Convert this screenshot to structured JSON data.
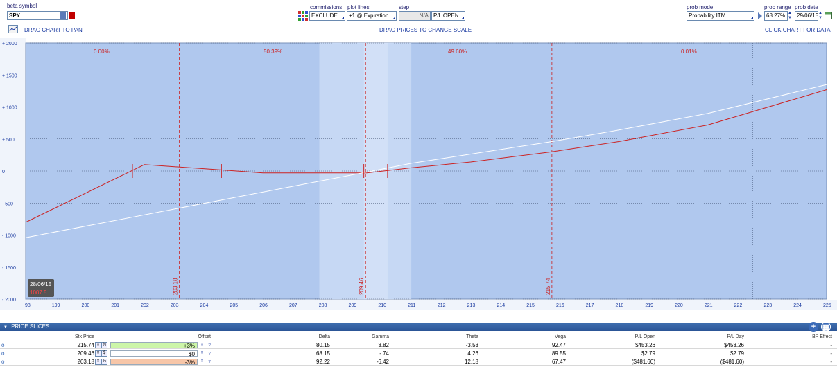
{
  "toolbar": {
    "beta_symbol_label": "beta symbol",
    "beta_symbol_value": "SPY",
    "commissions_label": "commissions",
    "commissions_value": "EXCLUDE",
    "plot_lines_label": "plot lines",
    "plot_lines_value": "+1 @ Expiration",
    "step_label": "step",
    "step_value": "N/A",
    "pl_value": "P/L OPEN",
    "prob_mode_label": "prob mode",
    "prob_mode_value": "Probability ITM",
    "prob_range_label": "prob range",
    "prob_range_value": "68.27%",
    "prob_date_label": "prob date",
    "prob_date_value": "29/06/15"
  },
  "hints": {
    "pan": "DRAG CHART TO PAN",
    "scale": "DRAG PRICES TO CHANGE SCALE",
    "data": "CLICK CHART FOR DATA"
  },
  "chart_data": {
    "type": "line",
    "x_ticks": [
      98,
      199,
      200,
      201,
      202,
      203,
      204,
      205,
      206,
      207,
      208,
      209,
      210,
      211,
      212,
      213,
      214,
      215,
      216,
      217,
      218,
      219,
      220,
      221,
      222,
      223,
      224,
      225
    ],
    "y_ticks": [
      2000,
      1500,
      1000,
      500,
      0,
      -500,
      -1000,
      -1500,
      -2000
    ],
    "y_tick_labels": [
      "+ 2000",
      "+ 1500",
      "+ 1000",
      "+ 500",
      "0",
      "- 500",
      "- 1000",
      "- 1500",
      "- 2000"
    ],
    "xlim": [
      198,
      225
    ],
    "ylim": [
      -2000,
      2000
    ],
    "probabilities": [
      "0.00%",
      "50.39%",
      "49.60%",
      "0.01%"
    ],
    "slice_lines": [
      {
        "x": 203.18,
        "label": "203.18"
      },
      {
        "x": 209.46,
        "label": "209.46"
      },
      {
        "x": 215.74,
        "label": "215.74"
      }
    ],
    "sigma_lines": [
      200,
      222.5
    ],
    "highlight_band": [
      207.9,
      211.0
    ],
    "current_band": [
      209.4,
      210.2
    ],
    "series": [
      {
        "color": "#cc2222",
        "points": [
          [
            198,
            -800
          ],
          [
            202,
            100
          ],
          [
            204.5,
            20
          ],
          [
            206,
            -30
          ],
          [
            209.5,
            -30
          ],
          [
            211,
            50
          ],
          [
            213,
            140
          ],
          [
            215.74,
            300
          ],
          [
            218,
            460
          ],
          [
            221,
            720
          ],
          [
            225,
            1270
          ]
        ]
      },
      {
        "color": "#ffffff",
        "points": [
          [
            198,
            -1040
          ],
          [
            209.46,
            -20
          ],
          [
            211,
            120
          ],
          [
            215.74,
            460
          ],
          [
            218,
            640
          ],
          [
            221,
            900
          ],
          [
            225,
            1350
          ]
        ]
      }
    ],
    "strike_marks": [
      201.6,
      204.6,
      209.4,
      210.2
    ],
    "tooltip": {
      "date": "28/06/15",
      "value": "1007.5"
    }
  },
  "price_slices": {
    "title": "PRICE SLICES",
    "columns": [
      "Stk Price",
      "Offset",
      "Delta",
      "Gamma",
      "Theta",
      "Vega",
      "P/L Open",
      "P/L Day",
      "BP Effect"
    ],
    "rows": [
      {
        "stk_price": "215.74",
        "offset": "+3%",
        "offset_color": "#ccf5a8",
        "unit": "%",
        "delta": "80.15",
        "gamma": "3.82",
        "theta": "-3.53",
        "vega": "92.47",
        "pl_open": "$453.26",
        "pl_day": "$453.26",
        "bp_effect": "-"
      },
      {
        "stk_price": "209.46",
        "offset": "$0",
        "offset_color": "#ffffff",
        "unit": "$",
        "delta": "68.15",
        "gamma": "-.74",
        "theta": "4.26",
        "vega": "89.55",
        "pl_open": "$2.79",
        "pl_day": "$2.79",
        "bp_effect": "-"
      },
      {
        "stk_price": "203.18",
        "offset": "-3%",
        "offset_color": "#f7c6a8",
        "unit": "%",
        "delta": "92.22",
        "gamma": "-6.42",
        "theta": "12.18",
        "vega": "67.47",
        "pl_open": "($481.60)",
        "pl_day": "($481.60)",
        "bp_effect": "-"
      }
    ]
  }
}
